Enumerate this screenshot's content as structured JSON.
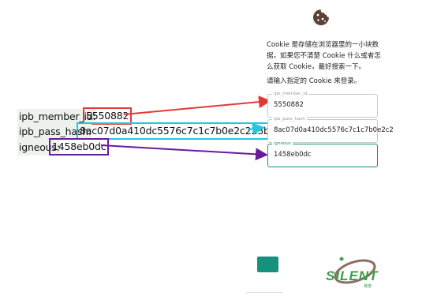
{
  "annotations": {
    "member_id": {
      "key": "ipb_member_id:",
      "value": "5550882"
    },
    "pass_hash": {
      "key": "ipb_pass_hash:",
      "value": "8ac07d0a410dc5576c7c1c7b0e2c223b"
    },
    "igneous": {
      "key": "igneous:",
      "value": "1458eb0dc"
    }
  },
  "dialog": {
    "icon": "cookie-icon",
    "description": "Cookie 是存储在浏览器里的一小块数据，如果您不清楚 Cookie 什么或者怎么获取 Cookie，最好搜索一下。",
    "prompt": "请输入指定的 Cookie 来登录。",
    "fields": [
      {
        "label": "ipb_member_id",
        "value": "5550882"
      },
      {
        "label": "ipb_pass_hash",
        "value": "8ac07d0a410dc5576c7c1c7b0e2c2"
      },
      {
        "label": "igneous",
        "value": "1458eb0dc"
      }
    ],
    "accent": "#138f7e"
  },
  "watermark": {
    "text": "SILENT",
    "sub": "赛偌"
  },
  "colors": {
    "red": "#e53935",
    "cyan": "#26c6da",
    "purple": "#6a1b9a",
    "accent": "#16917d"
  }
}
